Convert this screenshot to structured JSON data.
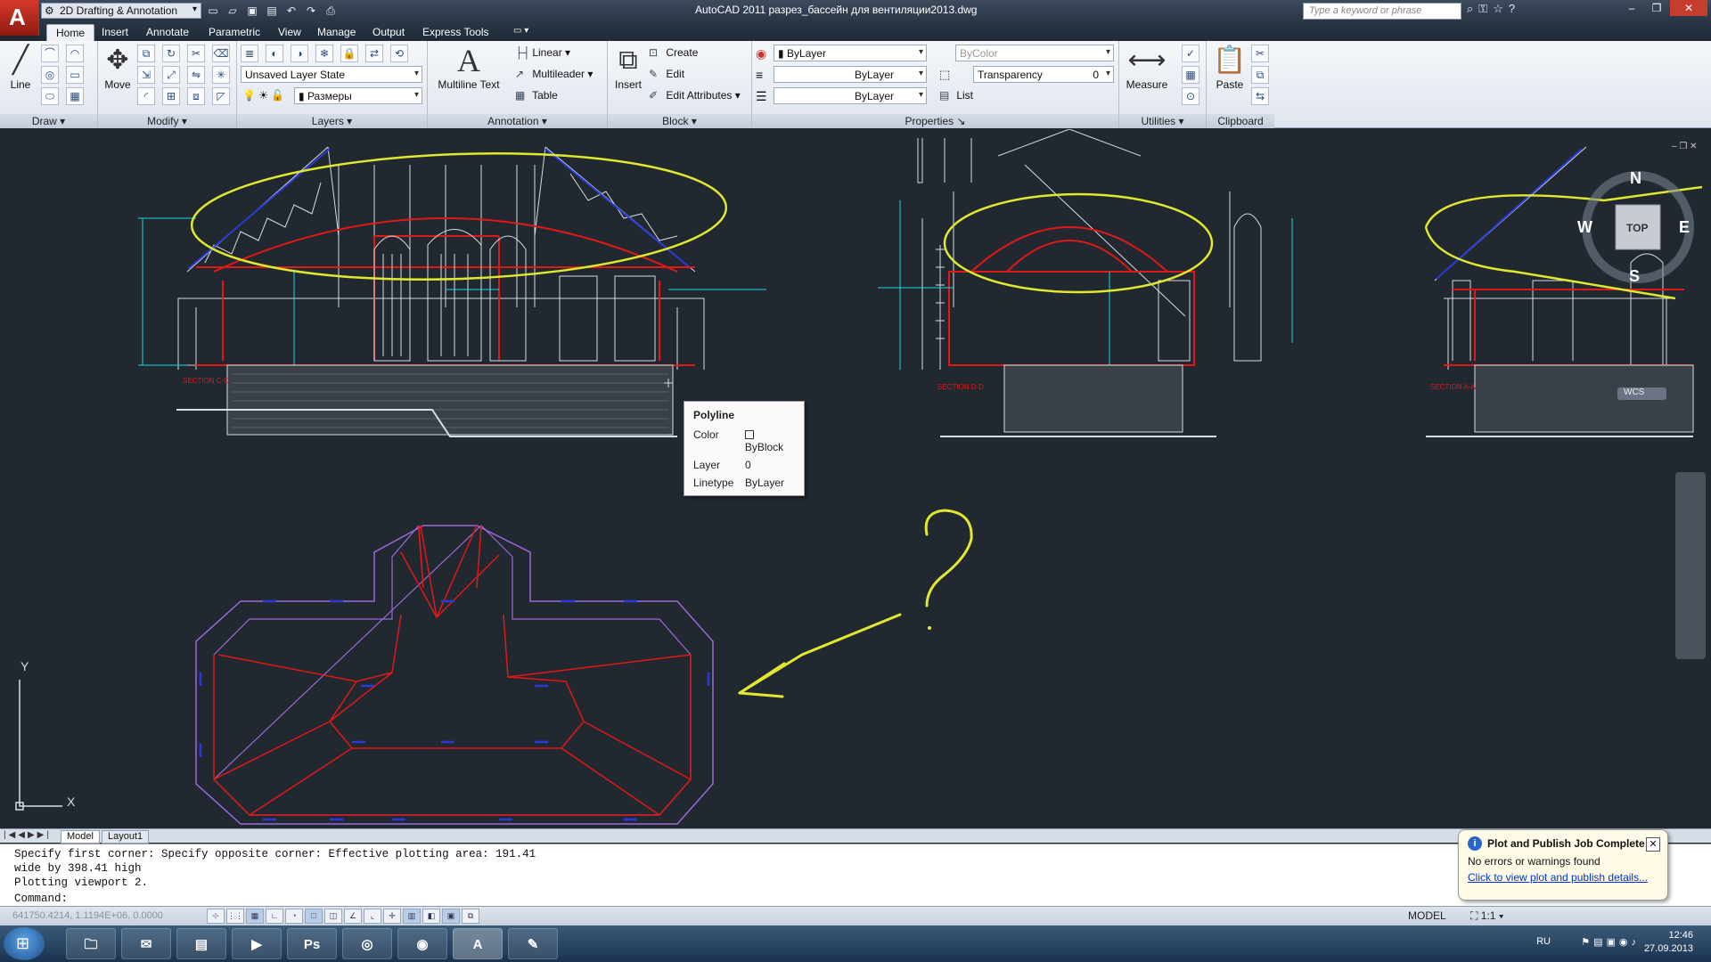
{
  "app": {
    "workspace": "2D Drafting & Annotation",
    "title": "AutoCAD 2011   разрез_бассейн для вентиляции2013.dwg",
    "search_placeholder": "Type a keyword or phrase"
  },
  "tabs": [
    "Home",
    "Insert",
    "Annotate",
    "Parametric",
    "View",
    "Manage",
    "Output",
    "Express Tools"
  ],
  "ribbon": {
    "draw": {
      "title": "Draw",
      "line": "Line"
    },
    "modify": {
      "title": "Modify",
      "move": "Move"
    },
    "layers": {
      "title": "Layers",
      "layer_state": "Unsaved Layer State",
      "current_layer": "Размеры"
    },
    "annotation": {
      "title": "Annotation",
      "multiline_text": "Multiline Text",
      "linear": "Linear",
      "multileader": "Multileader",
      "table": "Table"
    },
    "block": {
      "title": "Block",
      "insert": "Insert",
      "create": "Create",
      "edit": "Edit",
      "edit_attributes": "Edit Attributes"
    },
    "properties": {
      "title": "Properties",
      "color": "ByLayer",
      "lineweight": "ByLayer",
      "linetype": "ByLayer",
      "plot_style": "ByColor",
      "transparency_label": "Transparency",
      "transparency_value": "0",
      "list": "List"
    },
    "utilities": {
      "title": "Utilities",
      "measure": "Measure"
    },
    "clipboard": {
      "title": "Clipboard",
      "paste": "Paste"
    }
  },
  "tooltip": {
    "title": "Polyline",
    "color_label": "Color",
    "color_value": "ByBlock",
    "layer_label": "Layer",
    "layer_value": "0",
    "linetype_label": "Linetype",
    "linetype_value": "ByLayer"
  },
  "viewcube": {
    "n": "N",
    "s": "S",
    "e": "E",
    "w": "W",
    "top": "TOP",
    "wcs": "WCS"
  },
  "ucs": {
    "x": "X",
    "y": "Y"
  },
  "drawing_labels": {
    "question": "?"
  },
  "layout_tabs": [
    "Model",
    "Layout1"
  ],
  "command_history": [
    "Specify first corner: Specify opposite corner: Effective plotting area:  191.41",
    "wide by 398.41 high",
    "Plotting viewport 2."
  ],
  "command_prompt": "Command:",
  "status": {
    "coords": "641750.4214, 1.1194E+06, 0.0000",
    "model": "MODEL",
    "scale": "1:1"
  },
  "balloon": {
    "title": "Plot and Publish Job Complete",
    "message": "No errors or warnings found",
    "link": "Click to view plot and publish details..."
  },
  "taskbar": {
    "lang": "RU",
    "time": "12:46",
    "date": "27.09.2013",
    "apps": [
      "explorer",
      "outlook",
      "office",
      "media-player",
      "Ps",
      "steam",
      "chrome",
      "autocad",
      "notes"
    ]
  },
  "colors": {
    "canvas": "#212830",
    "red": "#e01818",
    "cyan": "#18d8e8",
    "yellow": "#e0e830",
    "white": "#d8dde4",
    "purple": "#9a6ad8",
    "blue": "#2a3ad8"
  }
}
